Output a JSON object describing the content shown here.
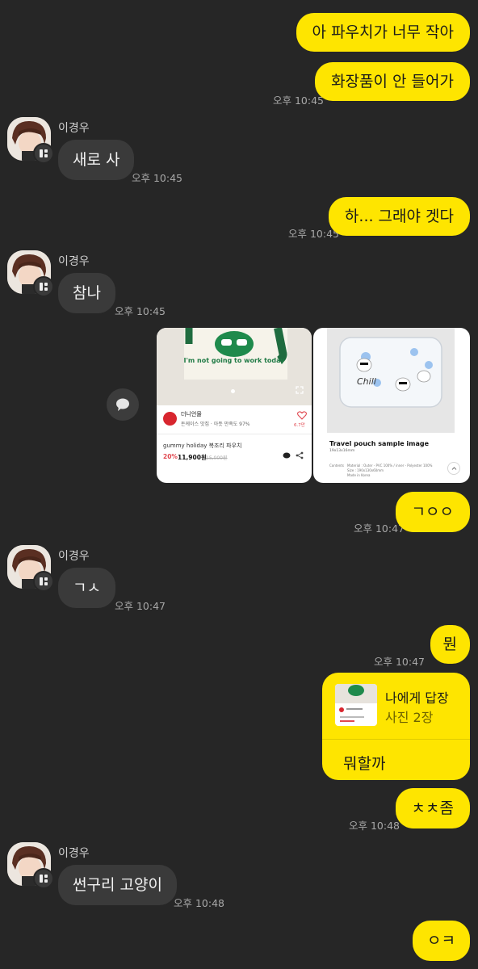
{
  "contact": {
    "name": "이경우"
  },
  "messages": [
    {
      "text": "아 파우치가 너무 작아"
    },
    {
      "text": "화장품이 안 들어가",
      "time": "오후 10:45"
    },
    {
      "text": "새로 사",
      "time": "오후 10:45"
    },
    {
      "text": "하... 그래야 겟다",
      "time": "오후 10:45"
    },
    {
      "text": "참나",
      "time": "오후 10:45"
    },
    {
      "text": "ㄱㅇㅇ",
      "time": "오후 10:47"
    },
    {
      "text": "ㄱㅅ",
      "time": "오후 10:47"
    },
    {
      "text": "뭔",
      "time": "오후 10:47"
    },
    {
      "text": "뭐할까",
      "time": "오후 10:48"
    },
    {
      "text": "ㅊㅊ좀",
      "time": "오후 10:48"
    },
    {
      "text": "썬구리 고양이",
      "time": "오후 10:48"
    },
    {
      "text": "ㅇㅋ"
    }
  ],
  "product_card": {
    "bag_text": "I'm not going to work today",
    "shop_name": "더니언몰",
    "shop_sub": "돈케이스 맛집 · 아뜻 만족도 97%",
    "like_count": "6.7만",
    "product_name": "gummy holiday 복조리 파우치",
    "discount": "20%",
    "price": "11,900원",
    "orig_price": "15,000원"
  },
  "pouch_card": {
    "pouch_text": "Chill",
    "title": "Travel pouch sample image",
    "size": "19x13x16mm",
    "contents_label": "Contents",
    "contents_1": "Material : Outer - PVC 100% / inner - Polyester 100%",
    "contents_2": "Size : 190x130x60mm",
    "contents_3": "Made in Korea"
  },
  "reply": {
    "title": "나에게 답장",
    "subtitle": "사진 2장"
  },
  "icons": {
    "share": "chat-bubble-icon",
    "heart": "heart-icon",
    "expand": "expand-icon",
    "up": "arrow-up-icon"
  },
  "colors": {
    "accent": "#FEE500",
    "background": "#262626",
    "other_bubble": "#3a3a3a"
  }
}
